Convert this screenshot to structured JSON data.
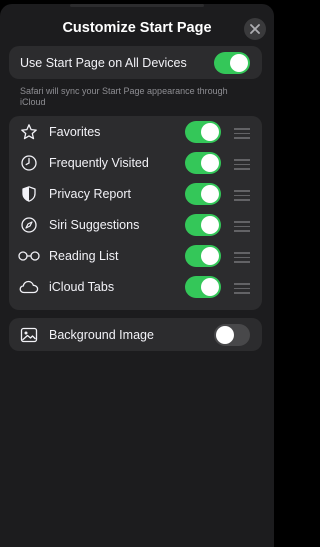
{
  "header": {
    "title": "Customize Start Page",
    "close_icon": "close-icon"
  },
  "sync": {
    "label": "Use Start Page on All Devices",
    "toggle_on": true,
    "footnote": "Safari will sync your Start Page appearance through iCloud"
  },
  "sections": [
    {
      "label": "Favorites",
      "icon": "star-icon",
      "enabled": true
    },
    {
      "label": "Frequently Visited",
      "icon": "clock-icon",
      "enabled": true
    },
    {
      "label": "Privacy Report",
      "icon": "shield-icon",
      "enabled": true
    },
    {
      "label": "Siri Suggestions",
      "icon": "compass-icon",
      "enabled": true
    },
    {
      "label": "Reading List",
      "icon": "glasses-icon",
      "enabled": true
    },
    {
      "label": "iCloud Tabs",
      "icon": "cloud-icon",
      "enabled": true
    }
  ],
  "background": {
    "label": "Background Image",
    "icon": "photo-icon",
    "toggle_on": false
  },
  "colors": {
    "sheet_background": "#1c1c1e",
    "card_background": "#2c2c2e",
    "toggle_on": "#34c759",
    "toggle_off": "#48484a",
    "secondary_text": "#8e8e93"
  }
}
